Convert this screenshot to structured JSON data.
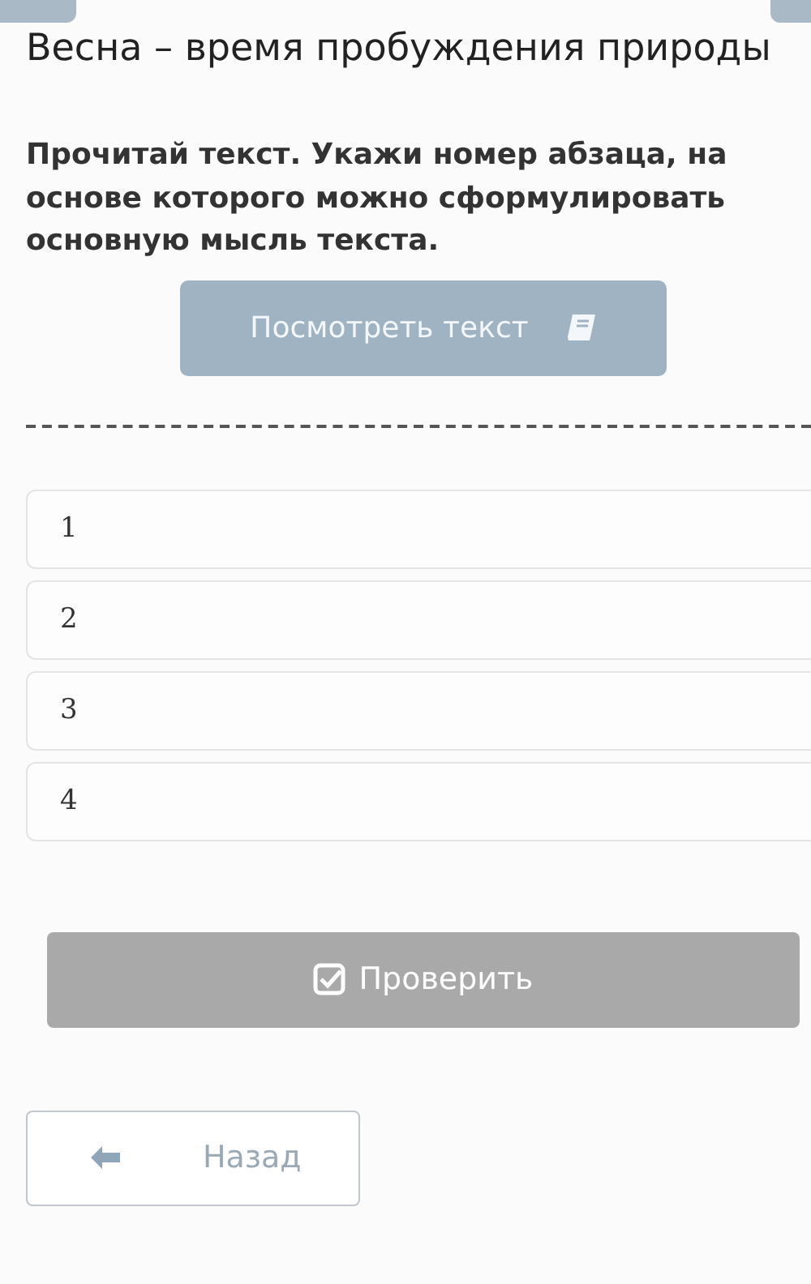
{
  "title": "Весна – время пробуждения природы",
  "question": "Прочитай текст. Укажи номер абзаца, на основе которого можно сформулировать основную мысль текста.",
  "view_button": {
    "label": "Посмотреть текст"
  },
  "options": [
    {
      "label": "1",
      "selected": false
    },
    {
      "label": "2",
      "selected": false
    },
    {
      "label": "3",
      "selected": false
    },
    {
      "label": "4",
      "selected": false
    }
  ],
  "check_button": {
    "label": "Проверить",
    "disabled": true
  },
  "back_button": {
    "label": "Назад"
  }
}
